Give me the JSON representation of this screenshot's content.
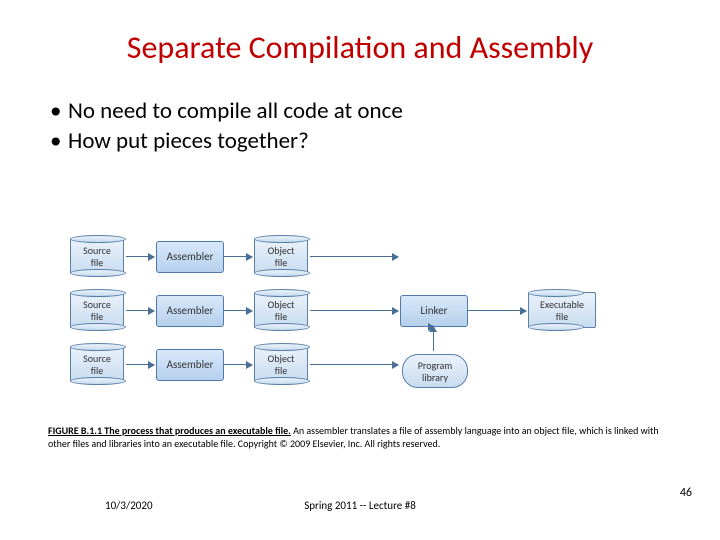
{
  "title": "Separate Compilation and Assembly",
  "bullets": {
    "b1": "No need to compile all code at once",
    "b2": "How put pieces together?"
  },
  "diagram": {
    "source": "Source\nfile",
    "assembler": "Assembler",
    "object": "Object\nfile",
    "linker": "Linker",
    "proglib": "Program\nlibrary",
    "exec": "Executable\nfile"
  },
  "caption": {
    "lead": "FIGURE B.1.1 The process that produces an executable file.",
    "rest": " An assembler translates a file of assembly language into an object file, which is linked with other files and libraries into an executable file. Copyright © 2009 Elsevier, Inc. All rights reserved."
  },
  "footer": {
    "date": "10/3/2020",
    "center": "Spring 2011 -- Lecture #8",
    "num": "46"
  }
}
